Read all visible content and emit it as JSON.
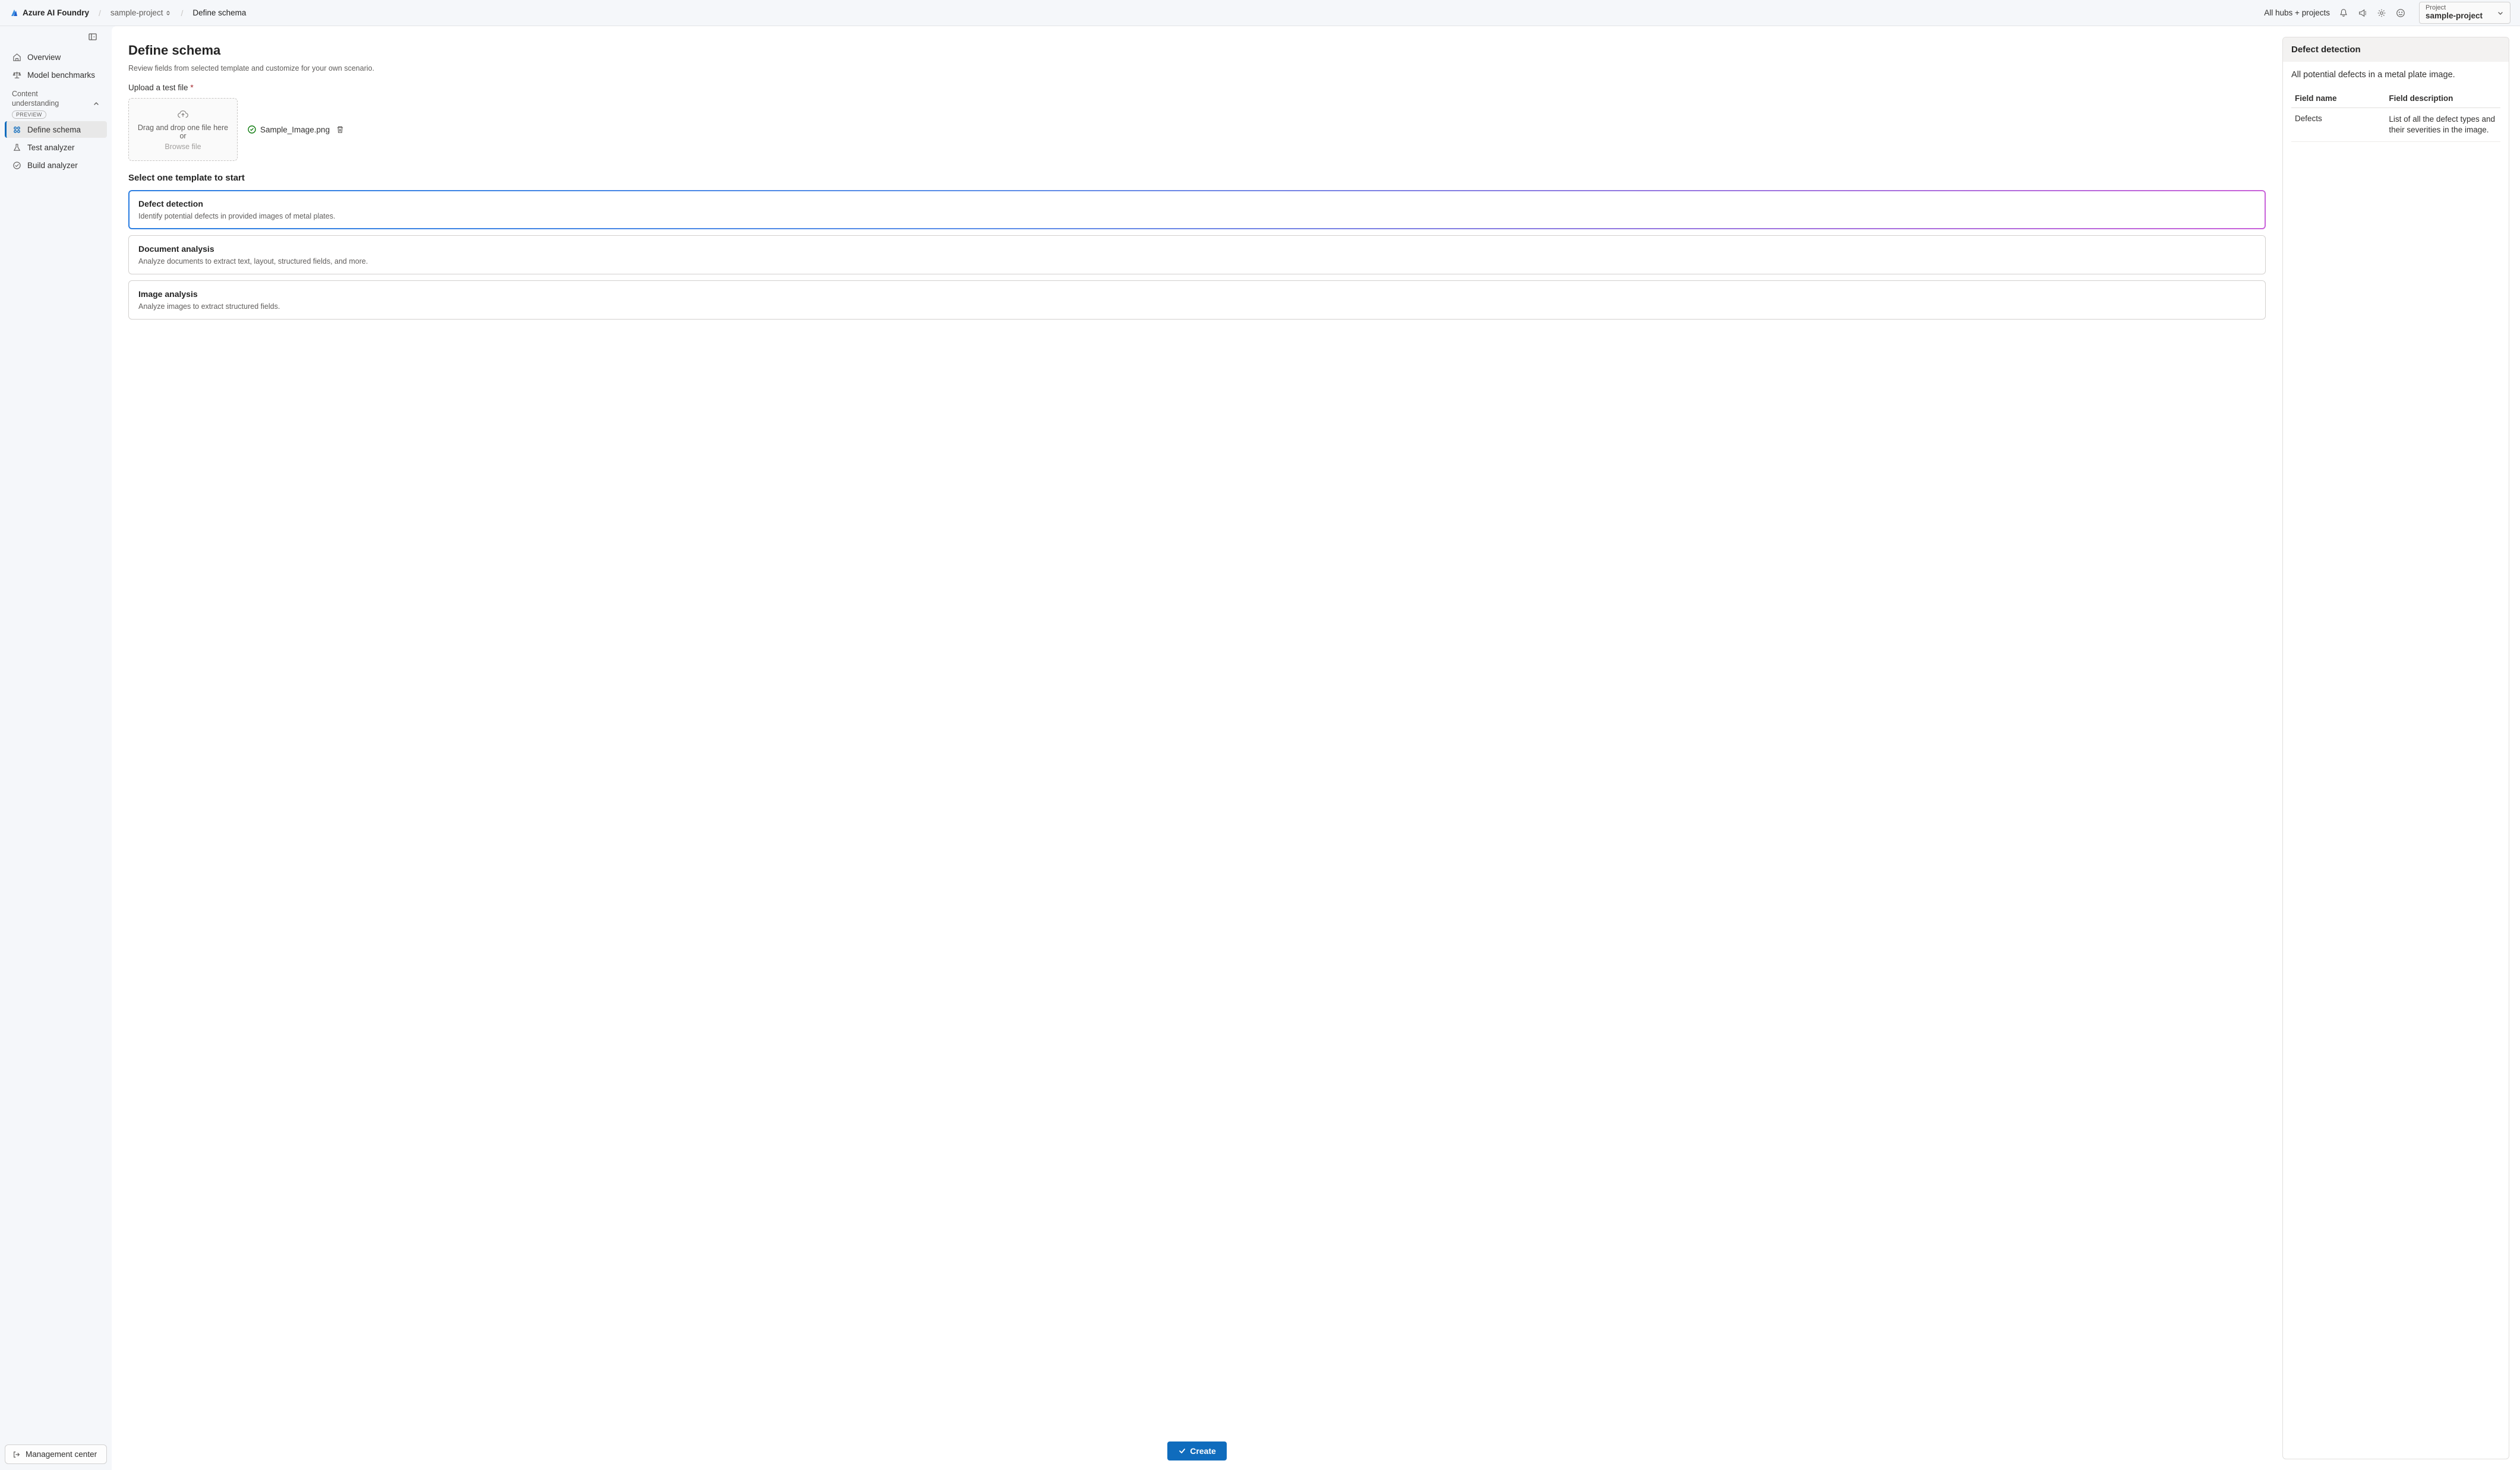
{
  "header": {
    "product": "Azure AI Foundry",
    "breadcrumb": {
      "project": "sample-project",
      "current": "Define schema"
    },
    "hubs_link": "All hubs + projects",
    "project_label": "Project",
    "project_name": "sample-project"
  },
  "sidebar": {
    "overview": "Overview",
    "model_benchmarks": "Model benchmarks",
    "section": {
      "title_line1": "Content",
      "title_line2": "understanding",
      "badge": "PREVIEW"
    },
    "define_schema": "Define schema",
    "test_analyzer": "Test analyzer",
    "build_analyzer": "Build analyzer",
    "management_center": "Management center"
  },
  "main": {
    "title": "Define schema",
    "subtitle": "Review fields from selected template and customize for your own scenario.",
    "upload_label": "Upload a test file",
    "dropzone": {
      "text": "Drag and drop one file here or",
      "browse": "Browse file"
    },
    "uploaded_file": "Sample_Image.png",
    "template_heading": "Select one template to start",
    "templates": [
      {
        "title": "Defect detection",
        "desc": "Identify potential defects in provided images of metal plates.",
        "selected": true
      },
      {
        "title": "Document analysis",
        "desc": "Analyze documents to extract text, layout, structured fields, and more.",
        "selected": false
      },
      {
        "title": "Image analysis",
        "desc": "Analyze images to extract structured fields.",
        "selected": false
      }
    ],
    "create_button": "Create"
  },
  "right": {
    "card_title": "Defect detection",
    "card_desc": "All potential defects in a metal plate image.",
    "table": {
      "col_name": "Field name",
      "col_desc": "Field description",
      "rows": [
        {
          "name": "Defects",
          "desc": "List of all the defect types and their severities in the image."
        }
      ]
    }
  }
}
